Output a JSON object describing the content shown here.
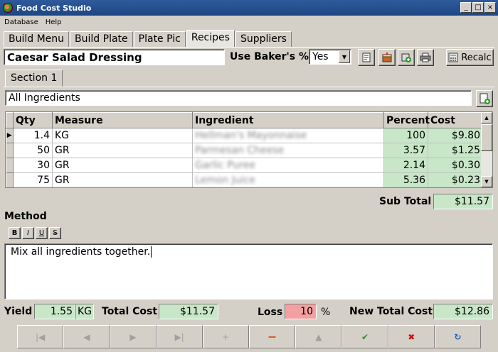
{
  "window": {
    "title": "Food Cost Studio",
    "controls": [
      "_",
      "□",
      "×"
    ]
  },
  "menu": [
    "Database",
    "Help"
  ],
  "tabs": [
    "Build Menu",
    "Build Plate",
    "Plate Pic",
    "Recipes",
    "Suppliers"
  ],
  "active_tab": "Recipes",
  "recipe": {
    "name": "Caesar Salad Dressing",
    "bakers_label": "Use Baker's %",
    "bakers_value": "Yes"
  },
  "toolbar": {
    "icons": [
      "document-icon",
      "cake-icon",
      "shopping-icon",
      "printer-icon"
    ],
    "recalc_label": "Recalc"
  },
  "section": {
    "tab_label": "Section 1",
    "filter_value": "All Ingredients"
  },
  "grid": {
    "columns": [
      "Qty",
      "Measure",
      "Ingredient",
      "Percent",
      "Cost"
    ],
    "rows": [
      {
        "qty": "1.4",
        "measure": "KG",
        "ingredient": "Hellman's Mayonnaise",
        "percent": "100",
        "cost": "$9.80"
      },
      {
        "qty": "50",
        "measure": "GR",
        "ingredient": "Parmesan Cheese",
        "percent": "3.57",
        "cost": "$1.25"
      },
      {
        "qty": "30",
        "measure": "GR",
        "ingredient": "Garlic Puree",
        "percent": "2.14",
        "cost": "$0.30"
      },
      {
        "qty": "75",
        "measure": "GR",
        "ingredient": "Lemon Juice",
        "percent": "5.36",
        "cost": "$0.23"
      }
    ]
  },
  "subtotal": {
    "label": "Sub Total",
    "value": "$11.57"
  },
  "method": {
    "label": "Method",
    "format_buttons": [
      "B",
      "I",
      "U",
      "S"
    ],
    "text": "Mix all ingredients together."
  },
  "footer": {
    "yield_label": "Yield",
    "yield_value": "1.55",
    "yield_unit": "KG",
    "total_cost_label": "Total Cost",
    "total_cost_value": "$11.57",
    "loss_label": "Loss",
    "loss_value": "10",
    "loss_unit": "%",
    "new_total_label": "New Total Cost",
    "new_total_value": "$12.86"
  },
  "nav": [
    {
      "name": "first-record-button",
      "glyph": "|◀",
      "state": "disabled"
    },
    {
      "name": "prior-record-button",
      "glyph": "◀",
      "state": "disabled"
    },
    {
      "name": "next-record-button",
      "glyph": "▶",
      "state": "disabled"
    },
    {
      "name": "last-record-button",
      "glyph": "▶|",
      "state": "disabled"
    },
    {
      "name": "insert-record-button",
      "glyph": "+",
      "state": "disabled"
    },
    {
      "name": "delete-record-button",
      "glyph": "−",
      "state": "enabled"
    },
    {
      "name": "edit-record-button",
      "glyph": "▲",
      "state": "disabled"
    },
    {
      "name": "post-edit-button",
      "glyph": "✔",
      "state": "enabled"
    },
    {
      "name": "cancel-edit-button",
      "glyph": "✖",
      "state": "enabled"
    },
    {
      "name": "refresh-data-button",
      "glyph": "↻",
      "state": "enabled"
    }
  ]
}
